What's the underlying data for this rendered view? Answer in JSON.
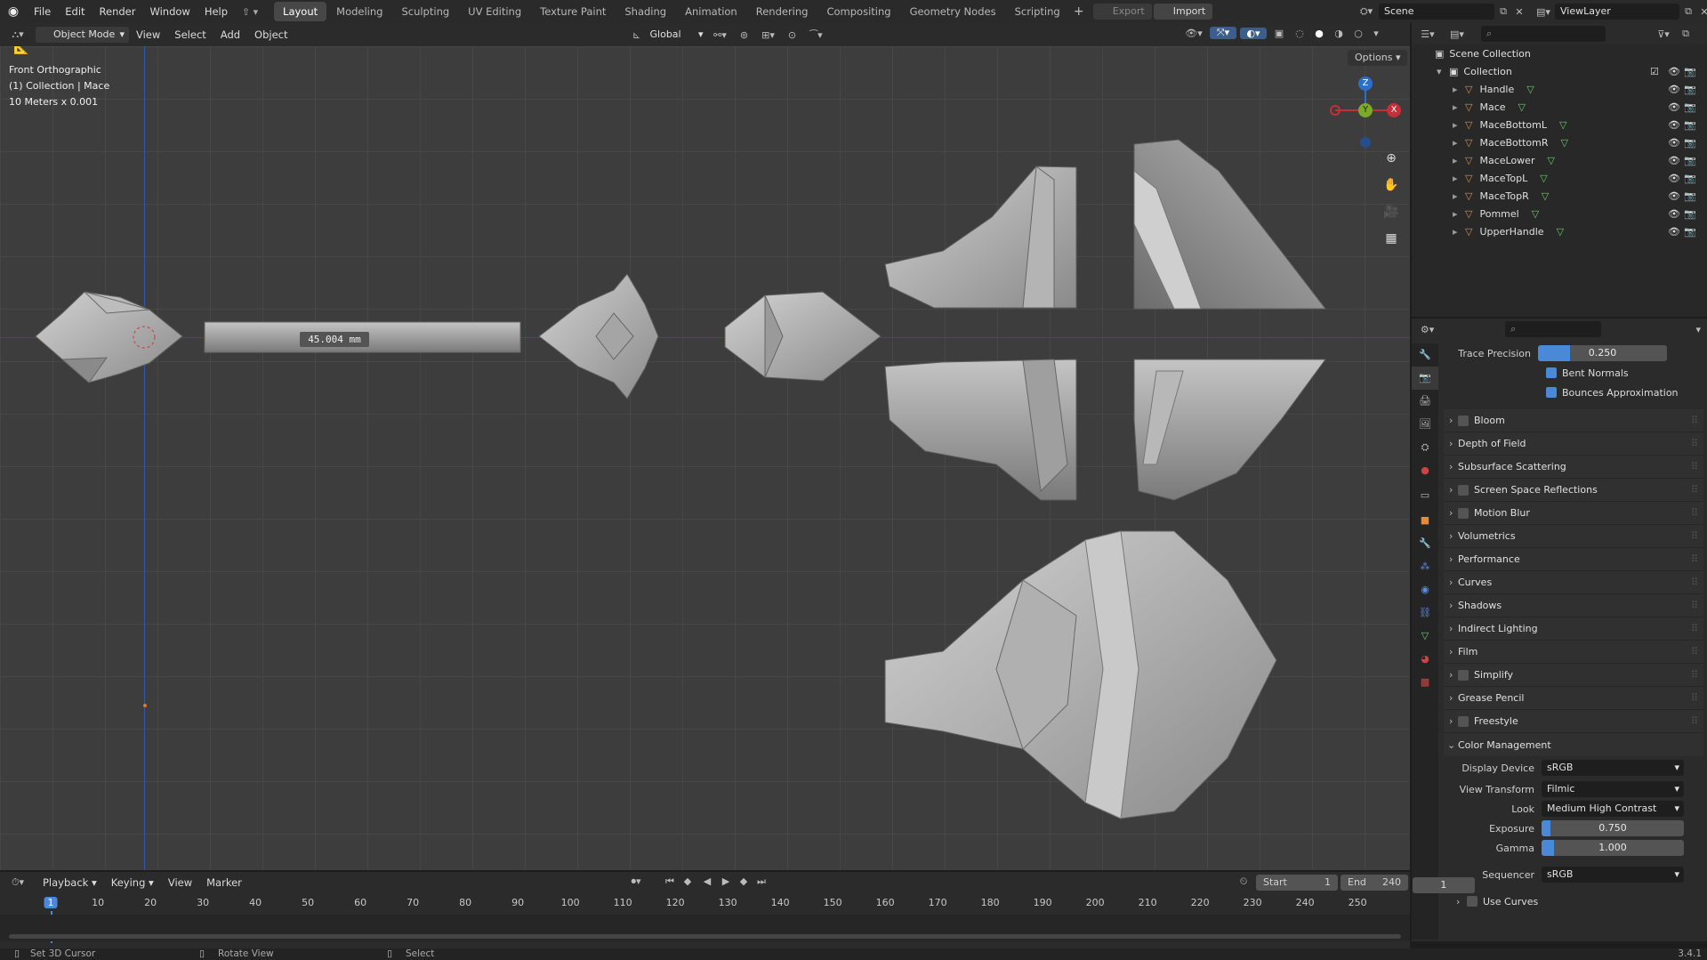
{
  "topbar": {
    "menus": [
      "File",
      "Edit",
      "Render",
      "Window",
      "Help"
    ],
    "workspaces": [
      "Layout",
      "Modeling",
      "Sculpting",
      "UV Editing",
      "Texture Paint",
      "Shading",
      "Animation",
      "Rendering",
      "Compositing",
      "Geometry Nodes",
      "Scripting"
    ],
    "active_workspace": "Layout",
    "export_label": "Export",
    "import_label": "Import",
    "scene": "Scene",
    "view_layer": "ViewLayer"
  },
  "viewport_header": {
    "mode": "Object Mode",
    "menus": [
      "View",
      "Select",
      "Add",
      "Object"
    ],
    "transform_orientation": "Global",
    "options_label": "Options"
  },
  "overlay": {
    "view_name": "Front Orthographic",
    "collection_info": "(1) Collection | Mace",
    "scale_info": "10 Meters x 0.001",
    "measure": "45.004 mm"
  },
  "gizmo": {
    "z": "Z",
    "y": "Y",
    "x": "X"
  },
  "outliner": {
    "root": "Scene Collection",
    "collection": "Collection",
    "objects": [
      "Handle",
      "Mace",
      "MaceBottomL",
      "MaceBottomR",
      "MaceLower",
      "MaceTopL",
      "MaceTopR",
      "Pommel",
      "UpperHandle"
    ]
  },
  "properties": {
    "trace_label": "Trace Precision",
    "trace_value": "0.250",
    "trace_fraction": 0.25,
    "bent_normals": "Bent Normals",
    "bounces": "Bounces Approximation",
    "panels": [
      {
        "label": "Bloom",
        "checkbox": true
      },
      {
        "label": "Depth of Field",
        "checkbox": false
      },
      {
        "label": "Subsurface Scattering",
        "checkbox": false
      },
      {
        "label": "Screen Space Reflections",
        "checkbox": true
      },
      {
        "label": "Motion Blur",
        "checkbox": true
      },
      {
        "label": "Volumetrics",
        "checkbox": false
      },
      {
        "label": "Performance",
        "checkbox": false
      },
      {
        "label": "Curves",
        "checkbox": false
      },
      {
        "label": "Shadows",
        "checkbox": false
      },
      {
        "label": "Indirect Lighting",
        "checkbox": false
      },
      {
        "label": "Film",
        "checkbox": false
      },
      {
        "label": "Simplify",
        "checkbox": true
      },
      {
        "label": "Grease Pencil",
        "checkbox": false
      },
      {
        "label": "Freestyle",
        "checkbox": true
      }
    ],
    "color_management": "Color Management",
    "display_device_label": "Display Device",
    "display_device": "sRGB",
    "view_transform_label": "View Transform",
    "view_transform": "Filmic",
    "look_label": "Look",
    "look": "Medium High Contrast",
    "exposure_label": "Exposure",
    "exposure": "0.750",
    "exposure_fraction": 0.06,
    "gamma_label": "Gamma",
    "gamma": "1.000",
    "gamma_fraction": 0.09,
    "sequencer_label": "Sequencer",
    "sequencer": "sRGB",
    "use_curves": "Use Curves"
  },
  "timeline": {
    "menus": [
      "Playback",
      "Keying",
      "View",
      "Marker"
    ],
    "current_frame": "1",
    "start_label": "Start",
    "start": "1",
    "end_label": "End",
    "end": "240",
    "ticks": [
      "1",
      "10",
      "20",
      "30",
      "40",
      "50",
      "60",
      "70",
      "80",
      "90",
      "100",
      "110",
      "120",
      "130",
      "140",
      "150",
      "160",
      "170",
      "180",
      "190",
      "200",
      "210",
      "220",
      "230",
      "240",
      "250"
    ]
  },
  "statusbar": {
    "left": "Set 3D Cursor",
    "middle": "Rotate View",
    "right": "Select",
    "version": "3.4.1"
  },
  "colors": {
    "accent": "#4a88d8",
    "x_axis": "#c4303a",
    "y_axis": "#7aaa2a",
    "z_axis": "#2d6ec9",
    "object_icon": "#e58a3a",
    "mesh_icon": "#6acb6a"
  }
}
